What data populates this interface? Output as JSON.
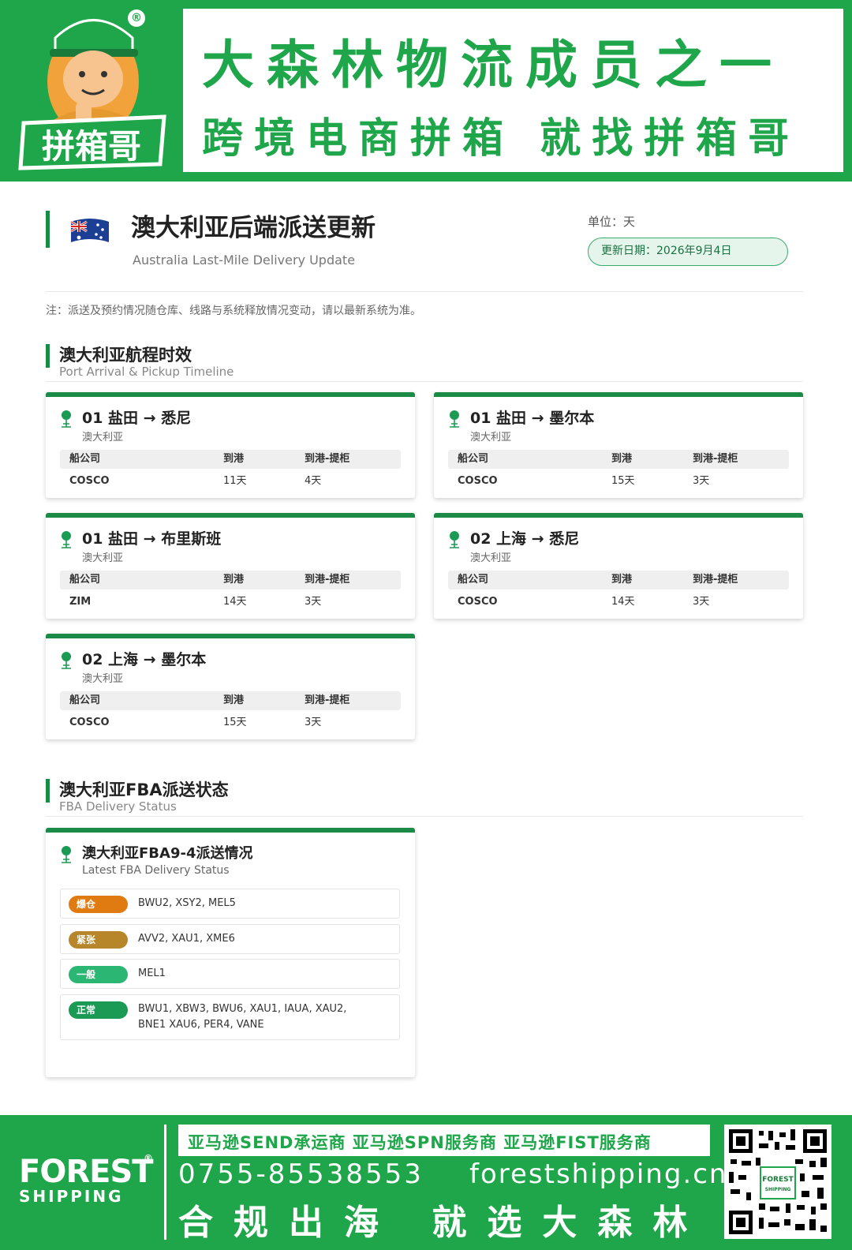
{
  "banner": {
    "brand_label": "拼箱哥",
    "registered": "®",
    "headline": "大森林物流成员之一",
    "tagline": "跨境电商拼箱  就找拼箱哥"
  },
  "header": {
    "title": "澳大利亚后端派送更新",
    "subtitle": "Australia Last-Mile Delivery Update",
    "unit": "单位：天",
    "update_date": "更新日期：2026年9月4日",
    "note": "注：派送及预约情况随仓库、线路与系统释放情况变动，请以最新系统为准。"
  },
  "sections": {
    "timeline": {
      "title": "澳大利亚航程时效",
      "subtitle": "Port Arrival & Pickup Timeline"
    },
    "fba": {
      "title": "澳大利亚FBA派送状态",
      "subtitle": "FBA Delivery Status"
    }
  },
  "table_headers": {
    "carrier": "船公司",
    "arrival": "到港",
    "pickup": "到港-提柜"
  },
  "routes": [
    {
      "title": "01 盐田 → 悉尼",
      "country": "澳大利亚",
      "carrier": "COSCO",
      "arrival": "11天",
      "pickup": "4天"
    },
    {
      "title": "01 盐田 → 墨尔本",
      "country": "澳大利亚",
      "carrier": "COSCO",
      "arrival": "15天",
      "pickup": "3天"
    },
    {
      "title": "01 盐田 → 布里斯班",
      "country": "澳大利亚",
      "carrier": "ZIM",
      "arrival": "14天",
      "pickup": "3天"
    },
    {
      "title": "02 上海 → 悉尼",
      "country": "澳大利亚",
      "carrier": "COSCO",
      "arrival": "14天",
      "pickup": "3天"
    },
    {
      "title": "02 上海 → 墨尔本",
      "country": "澳大利亚",
      "carrier": "COSCO",
      "arrival": "15天",
      "pickup": "3天"
    }
  ],
  "fba_card": {
    "title": "澳大利亚FBA9-4派送情况",
    "subtitle": "Latest FBA Delivery Status",
    "rows": [
      {
        "status": "爆仓",
        "color": "#e07b12",
        "codes": "BWU2, XSY2, MEL5"
      },
      {
        "status": "紧张",
        "color": "#b8862a",
        "codes": "AVV2, XAU1, XME6"
      },
      {
        "status": "一般",
        "color": "#2bb673",
        "codes": "MEL1"
      },
      {
        "status": "正常",
        "color": "#1a9a55",
        "codes": "BWU1, XBW3, BWU6, XAU1, IAUA, XAU2, BNE1 XAU6, PER4, VANE"
      }
    ]
  },
  "footer": {
    "logo_top": "FOREST",
    "logo_bottom": "SHIPPING",
    "logo_reg": "®",
    "services": "亚马逊SEND承运商  亚马逊SPN服务商  亚马逊FIST服务商",
    "phone": "0755-85538553",
    "website": "forestshipping.cn",
    "slogan": "合规出海  就选大森林"
  },
  "colors": {
    "brand_green": "#1fa64a",
    "accent_green": "#1a8a46"
  }
}
